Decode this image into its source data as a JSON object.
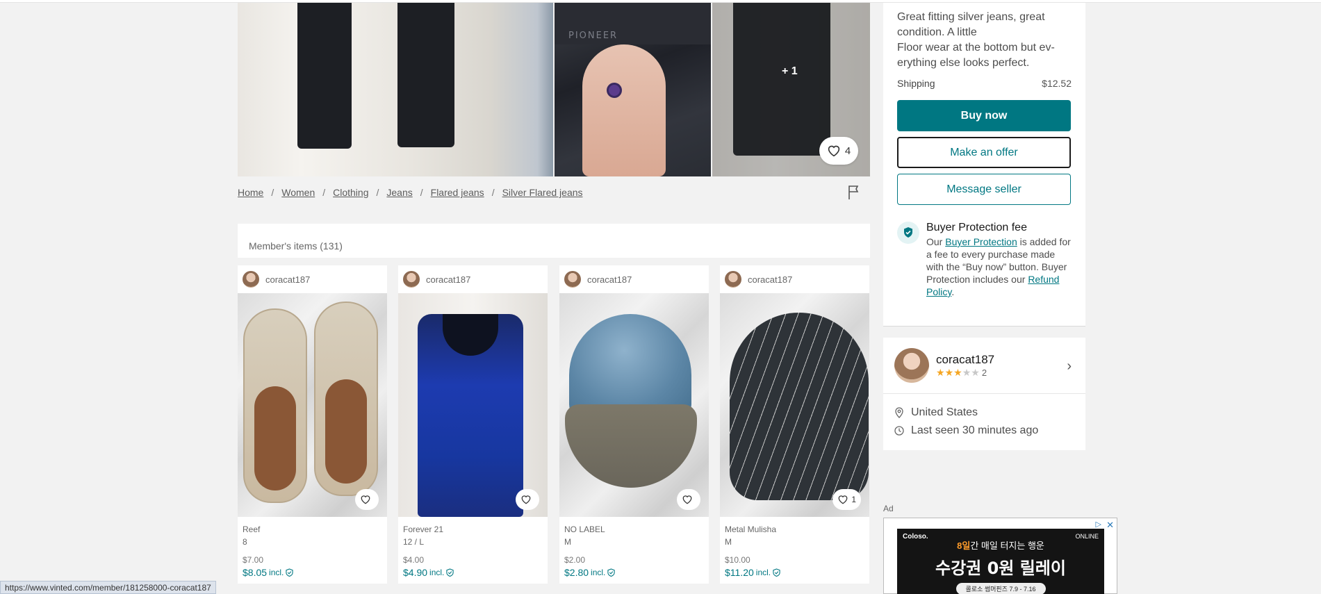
{
  "gallery": {
    "waist_text": "PIONEER",
    "more_photos": "+ 1",
    "likes": "4"
  },
  "breadcrumb": [
    "Home",
    "Women",
    "Clothing",
    "Jeans",
    "Flared jeans",
    "Silver Flared jeans"
  ],
  "members": {
    "title": "Member's items (131)"
  },
  "cards": [
    {
      "user": "coracat187",
      "brand": "Reef",
      "size": "8",
      "price": "$7.00",
      "price_incl": "$8.05",
      "incl": "incl.",
      "likes": ""
    },
    {
      "user": "coracat187",
      "brand": "Forever 21",
      "size": "12 / L",
      "price": "$4.00",
      "price_incl": "$4.90",
      "incl": "incl.",
      "likes": ""
    },
    {
      "user": "coracat187",
      "brand": "NO LABEL",
      "size": "M",
      "price": "$2.00",
      "price_incl": "$2.80",
      "incl": "incl.",
      "likes": ""
    },
    {
      "user": "coracat187",
      "brand": "Metal Mulisha",
      "size": "M",
      "price": "$10.00",
      "price_incl": "$11.20",
      "incl": "incl.",
      "likes": "1"
    }
  ],
  "item": {
    "description_1": "Great fitting silver jeans, great condition. A little",
    "description_2": "Floor wear at the bottom but ev-erything else looks perfect.",
    "shipping_label": "Shipping",
    "shipping_value": "$12.52"
  },
  "actions": {
    "buy": "Buy now",
    "offer": "Make an offer",
    "message": "Message seller"
  },
  "protection": {
    "title": "Buyer Protection fee",
    "pre": "Our ",
    "link": "Buyer Protection",
    "mid": " is added for a fee to every purchase made with the “Buy now” button. Buyer Protection includes our ",
    "policy": "Refund Policy",
    "end": "."
  },
  "seller": {
    "name": "coracat187",
    "rating": 3,
    "reviews": "2",
    "location": "United States",
    "last_seen": "Last seen 30 minutes ago"
  },
  "ad": {
    "label": "Ad",
    "brand": "Coloso.",
    "online": "ONLINE",
    "line1_highlight": "8일",
    "line1": "간 매일 터지는 행운",
    "line2": "수강권 0원 릴레이",
    "line3": "콜로소 썸머핀즈 7.9 - 7.16"
  },
  "status_url": "https://www.vinted.com/member/181258000-coracat187",
  "colors": {
    "accent": "#007782",
    "star": "#f5a623"
  }
}
